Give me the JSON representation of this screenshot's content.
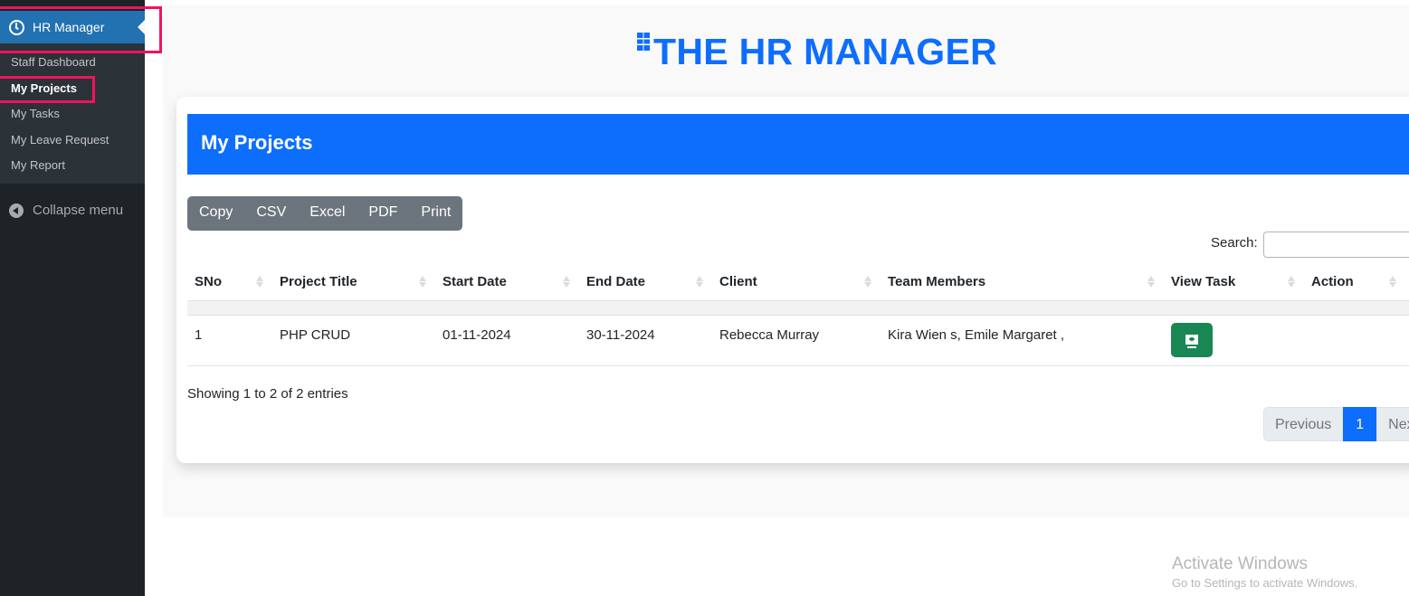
{
  "sidebar": {
    "menu_head": {
      "label": "HR Manager",
      "icon": "clock-icon"
    },
    "items": [
      {
        "label": "Staff Dashboard",
        "active": false
      },
      {
        "label": "My Projects",
        "active": true
      },
      {
        "label": "My Tasks",
        "active": false
      },
      {
        "label": "My Leave Request",
        "active": false
      },
      {
        "label": "My Report",
        "active": false
      }
    ],
    "collapse_label": "Collapse menu"
  },
  "header": {
    "title": "THE HR MANAGER",
    "icon": "building-icon"
  },
  "card": {
    "title": "My Projects",
    "export_buttons": [
      "Copy",
      "CSV",
      "Excel",
      "PDF",
      "Print"
    ],
    "search": {
      "label": "Search:",
      "value": "",
      "placeholder": ""
    },
    "table": {
      "columns": [
        "SNo",
        "Project Title",
        "Start Date",
        "End Date",
        "Client",
        "Team Members",
        "View Task",
        "Action"
      ],
      "rows": [
        {
          "sno": "1",
          "project_title": "PHP CRUD",
          "start_date": "01-11-2024",
          "end_date": "30-11-2024",
          "client": "Rebecca Murray",
          "team_members": "Kira Wien s, Emile Margaret ,",
          "view_task_icon": "monitor-eye-icon",
          "action": ""
        }
      ]
    },
    "info": "Showing 1 to 2 of 2 entries",
    "pagination": {
      "previous": "Previous",
      "current": "1",
      "next": "Next"
    }
  },
  "colors": {
    "primary": "#0d6efd",
    "success": "#198754",
    "secondary": "#6c757d",
    "sidebar": "#1d2327",
    "wp_blue": "#2271b1",
    "highlight": "#f0135e"
  },
  "watermark": {
    "line1": "Activate Windows",
    "line2": "Go to Settings to activate Windows."
  }
}
